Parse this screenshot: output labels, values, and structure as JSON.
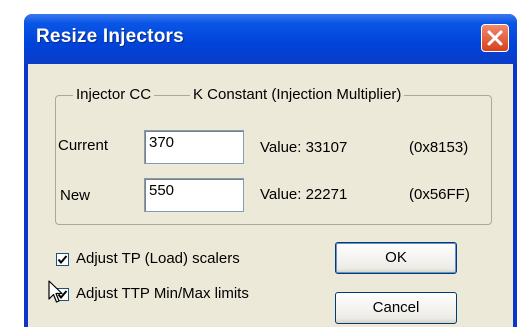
{
  "window": {
    "title": "Resize Injectors",
    "close_icon": "close-x-icon"
  },
  "group": {
    "label_cc": "Injector CC",
    "label_k": "K Constant (Injection Multiplier)"
  },
  "rows": {
    "current": {
      "label": "Current",
      "input_value": "370",
      "value_text": "Value: 33107",
      "hex_text": "(0x8153)"
    },
    "new": {
      "label": "New",
      "input_value": "550",
      "value_text": "Value: 22271",
      "hex_text": "(0x56FF)"
    }
  },
  "options": {
    "adjust_tp": {
      "label": "Adjust TP (Load) scalers",
      "checked": true
    },
    "adjust_ttp": {
      "label": "Adjust TTP Min/Max limits",
      "checked": true
    }
  },
  "buttons": {
    "ok": "OK",
    "cancel": "Cancel"
  },
  "colors": {
    "titlebar": "#0043d9",
    "client": "#ece9d8",
    "close_button": "#d6401c"
  }
}
